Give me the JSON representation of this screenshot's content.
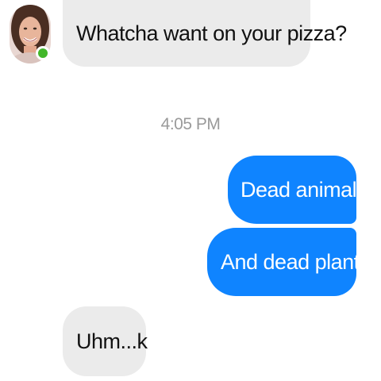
{
  "conversation": {
    "contact": {
      "avatar_icon": "contact-avatar-photo",
      "online_status_color": "#42b72a"
    },
    "messages": [
      {
        "direction": "incoming",
        "text": "Whatcha want on your pizza?"
      },
      {
        "direction": "outgoing",
        "text": "Dead animals"
      },
      {
        "direction": "outgoing",
        "text": "And dead plants"
      },
      {
        "direction": "incoming",
        "text": "Uhm...k"
      }
    ],
    "timestamp": "4:05 PM"
  },
  "colors": {
    "outgoing_bubble": "#0f84ff",
    "incoming_bubble": "#ebebeb",
    "timestamp_text": "#9a9a9a"
  }
}
